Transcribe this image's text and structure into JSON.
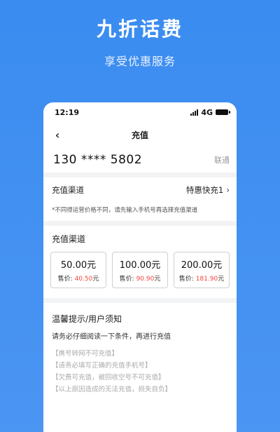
{
  "hero": {
    "title": "九折话费",
    "subtitle": "享受优惠服务"
  },
  "status_bar": {
    "time": "12:19",
    "network": "4G"
  },
  "nav": {
    "title": "充值"
  },
  "account": {
    "phone_number": "130 **** 5802",
    "carrier": "联通"
  },
  "channel": {
    "label": "充值渠道",
    "value": "特惠快充1",
    "notice": "*不同得运营价格不同，请先输入手机号再选择充值渠道"
  },
  "products": {
    "title": "充值渠道",
    "price_label": "售价:",
    "unit": "元",
    "items": [
      {
        "amount": "50.00元",
        "price": "40.50"
      },
      {
        "amount": "100.00元",
        "price": "90.90"
      },
      {
        "amount": "200.00元",
        "price": "181.90"
      }
    ]
  },
  "tips": {
    "title": "温馨提示/用户须知",
    "subtitle": "请务必仔细阅读一下条件，再进行充值",
    "items": [
      "【携号转网不可充值】",
      "【请务必填写正确的充值手机号】",
      "【欠费可充值，被回收空号不可充值】",
      "【以上原因造成的无法充值，损失自负】"
    ]
  },
  "colors": {
    "background": "#3a8cf0",
    "accent_red": "#f0453c"
  }
}
